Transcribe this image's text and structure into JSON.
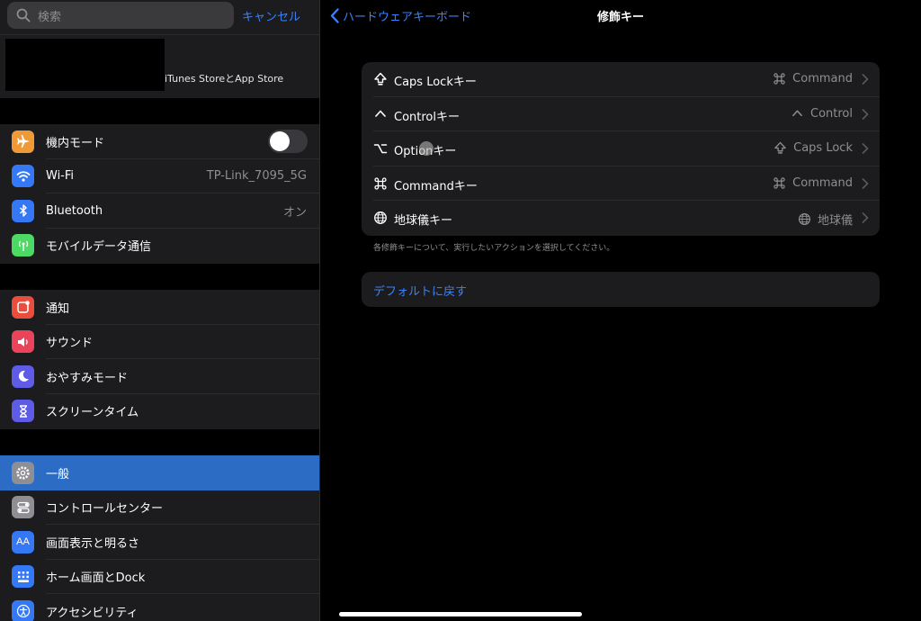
{
  "sidebar": {
    "search": {
      "placeholder": "検索",
      "cancel_label": "キャンセル"
    },
    "account": {
      "text": "iTunes StoreとApp Store"
    },
    "group1": [
      {
        "label": "機内モード",
        "icon": "airplane-icon",
        "color": "#f09a37",
        "toggle": false
      },
      {
        "label": "Wi-Fi",
        "icon": "wifi-icon",
        "color": "#3478f6",
        "value": "TP-Link_7095_5G"
      },
      {
        "label": "Bluetooth",
        "icon": "bluetooth-icon",
        "color": "#3478f6",
        "value": "オン"
      },
      {
        "label": "モバイルデータ通信",
        "icon": "cellular-icon",
        "color": "#4cd964"
      }
    ],
    "group2": [
      {
        "label": "通知",
        "icon": "notifications-icon",
        "color": "#eb4d3d"
      },
      {
        "label": "サウンド",
        "icon": "sounds-icon",
        "color": "#eb445a"
      },
      {
        "label": "おやすみモード",
        "icon": "moon-icon",
        "color": "#5e5ce6"
      },
      {
        "label": "スクリーンタイム",
        "icon": "hourglass-icon",
        "color": "#5e5ce6"
      }
    ],
    "group3": [
      {
        "label": "一般",
        "icon": "gear-icon",
        "color": "#8e8e93",
        "selected": true
      },
      {
        "label": "コントロールセンター",
        "icon": "switches-icon",
        "color": "#8e8e93"
      },
      {
        "label": "画面表示と明るさ",
        "icon": "text-size-icon",
        "color": "#3478f6"
      },
      {
        "label": "ホーム画面とDock",
        "icon": "home-grid-icon",
        "color": "#3478f6"
      },
      {
        "label": "アクセシビリティ",
        "icon": "accessibility-icon",
        "color": "#3478f6"
      }
    ]
  },
  "detail": {
    "back_label": "ハードウェアキーボード",
    "title": "修飾キー",
    "keys": [
      {
        "label": "Caps Lockキー",
        "icon": "caps-lock-icon",
        "value": "Command",
        "value_icon": "command-icon"
      },
      {
        "label": "Controlキー",
        "icon": "control-icon",
        "value": "Control",
        "value_icon": "control-icon"
      },
      {
        "label": "Optionキー",
        "icon": "option-icon",
        "value": "Caps Lock",
        "value_icon": "caps-lock-icon"
      },
      {
        "label": "Commandキー",
        "icon": "command-icon",
        "value": "Command",
        "value_icon": "command-icon"
      },
      {
        "label": "地球儀キー",
        "icon": "globe-icon",
        "value": "地球儀",
        "value_icon": "globe-icon"
      }
    ],
    "footnote": "各修飾キーについて、実行したいアクションを選択してください。",
    "reset_label": "デフォルトに戻す"
  },
  "colors": {
    "accent": "#3a82f7",
    "selected_row": "#2d6cc4",
    "background": "#000000",
    "cell": "#1c1c1e"
  }
}
